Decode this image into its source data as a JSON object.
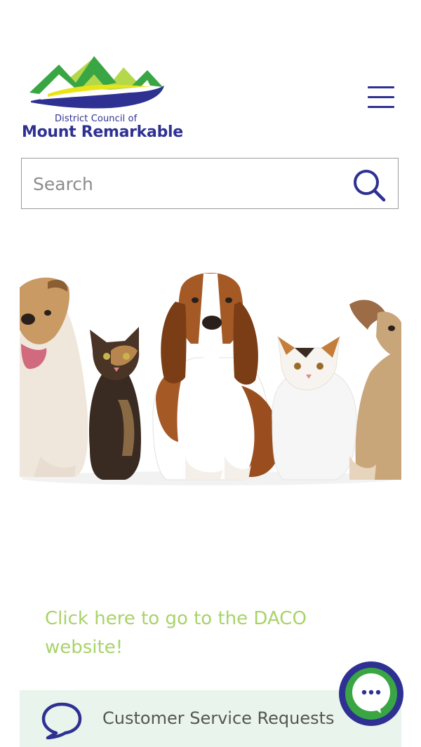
{
  "header": {
    "logo": {
      "line1": "District Council of",
      "line2": "Mount Remarkable"
    },
    "menu_icon": "hamburger-menu-icon"
  },
  "search": {
    "placeholder": "Search",
    "value": "",
    "icon": "search-icon"
  },
  "hero": {
    "image": "pets-dogs-and-cats-photo"
  },
  "daco": {
    "link_text": "Click here to go to the DACO website!"
  },
  "service_bar": {
    "icon": "speech-bubble-icon",
    "label": "Customer Service Requests"
  },
  "chat": {
    "icon": "chat-bubble-icon"
  },
  "colors": {
    "brand_blue": "#2e3192",
    "brand_green": "#3aa643",
    "link_green": "#a8d36a",
    "service_bar_bg": "#e9f4ec"
  }
}
